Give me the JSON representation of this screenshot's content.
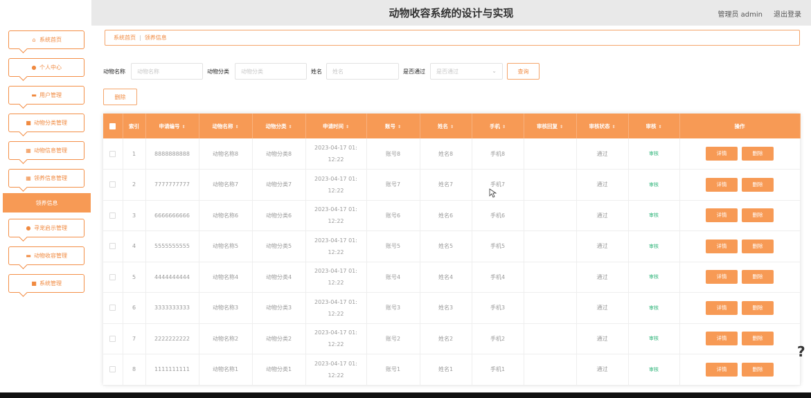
{
  "header": {
    "title": "动物收容系统的设计与实现",
    "user": "管理员 admin",
    "logout": "退出登录"
  },
  "sidebar": {
    "items": [
      {
        "label": "系统首页",
        "icon": "home-icon"
      },
      {
        "label": "个人中心",
        "icon": "user-icon"
      },
      {
        "label": "用户管理",
        "icon": "users-icon"
      },
      {
        "label": "动物分类管理",
        "icon": "category-icon"
      },
      {
        "label": "动物信息管理",
        "icon": "grid-icon"
      },
      {
        "label": "领养信息管理",
        "icon": "grid-icon"
      },
      {
        "label": "寻宠启示管理",
        "icon": "pin-icon"
      },
      {
        "label": "动物收容管理",
        "icon": "shelter-icon"
      },
      {
        "label": "系统管理",
        "icon": "settings-icon"
      }
    ],
    "active_sub": "领养信息"
  },
  "breadcrumb": {
    "home": "系统首页",
    "current": "领养信息"
  },
  "search": {
    "animal_name_label": "动物名称",
    "animal_name_placeholder": "动物名称",
    "category_label": "动物分类",
    "category_placeholder": "动物分类",
    "name_label": "姓名",
    "name_placeholder": "姓名",
    "passed_label": "是否通过",
    "passed_placeholder": "是否通过",
    "query_button": "查询"
  },
  "delete_button": "删除",
  "table": {
    "columns": [
      "索引",
      "申请编号",
      "动物名称",
      "动物分类",
      "申请时间",
      "账号",
      "姓名",
      "手机",
      "审核回复",
      "审核状态",
      "审核",
      "操作"
    ],
    "rows": [
      {
        "index": "1",
        "code": "8888888888",
        "name": "动物名称8",
        "category": "动物分类8",
        "time1": "2023-04-17 01:",
        "time2": "12:22",
        "account": "账号8",
        "person": "姓名8",
        "phone": "手机8",
        "reply": "",
        "status": "通过",
        "audit": "审核",
        "detail": "详情",
        "delete": "删除"
      },
      {
        "index": "2",
        "code": "7777777777",
        "name": "动物名称7",
        "category": "动物分类7",
        "time1": "2023-04-17 01:",
        "time2": "12:22",
        "account": "账号7",
        "person": "姓名7",
        "phone": "手机7",
        "reply": "",
        "status": "通过",
        "audit": "审核",
        "detail": "详情",
        "delete": "删除"
      },
      {
        "index": "3",
        "code": "6666666666",
        "name": "动物名称6",
        "category": "动物分类6",
        "time1": "2023-04-17 01:",
        "time2": "12:22",
        "account": "账号6",
        "person": "姓名6",
        "phone": "手机6",
        "reply": "",
        "status": "通过",
        "audit": "审核",
        "detail": "详情",
        "delete": "删除"
      },
      {
        "index": "4",
        "code": "5555555555",
        "name": "动物名称5",
        "category": "动物分类5",
        "time1": "2023-04-17 01:",
        "time2": "12:22",
        "account": "账号5",
        "person": "姓名5",
        "phone": "手机5",
        "reply": "",
        "status": "通过",
        "audit": "审核",
        "detail": "详情",
        "delete": "删除"
      },
      {
        "index": "5",
        "code": "4444444444",
        "name": "动物名称4",
        "category": "动物分类4",
        "time1": "2023-04-17 01:",
        "time2": "12:22",
        "account": "账号4",
        "person": "姓名4",
        "phone": "手机4",
        "reply": "",
        "status": "通过",
        "audit": "审核",
        "detail": "详情",
        "delete": "删除"
      },
      {
        "index": "6",
        "code": "3333333333",
        "name": "动物名称3",
        "category": "动物分类3",
        "time1": "2023-04-17 01:",
        "time2": "12:22",
        "account": "账号3",
        "person": "姓名3",
        "phone": "手机3",
        "reply": "",
        "status": "通过",
        "audit": "审核",
        "detail": "详情",
        "delete": "删除"
      },
      {
        "index": "7",
        "code": "2222222222",
        "name": "动物名称2",
        "category": "动物分类2",
        "time1": "2023-04-17 01:",
        "time2": "12:22",
        "account": "账号2",
        "person": "姓名2",
        "phone": "手机2",
        "reply": "",
        "status": "通过",
        "audit": "审核",
        "detail": "详情",
        "delete": "删除"
      },
      {
        "index": "8",
        "code": "1111111111",
        "name": "动物名称1",
        "category": "动物分类1",
        "time1": "2023-04-17 01:",
        "time2": "12:22",
        "account": "账号1",
        "person": "姓名1",
        "phone": "手机1",
        "reply": "",
        "status": "通过",
        "audit": "审核",
        "detail": "详情",
        "delete": "删除"
      }
    ]
  },
  "help_glyph": "?",
  "colors": {
    "accent": "#f79a55",
    "accent_text": "#f08a40",
    "header_bg": "#e9e9e9",
    "audit_green": "#2fb47a"
  }
}
